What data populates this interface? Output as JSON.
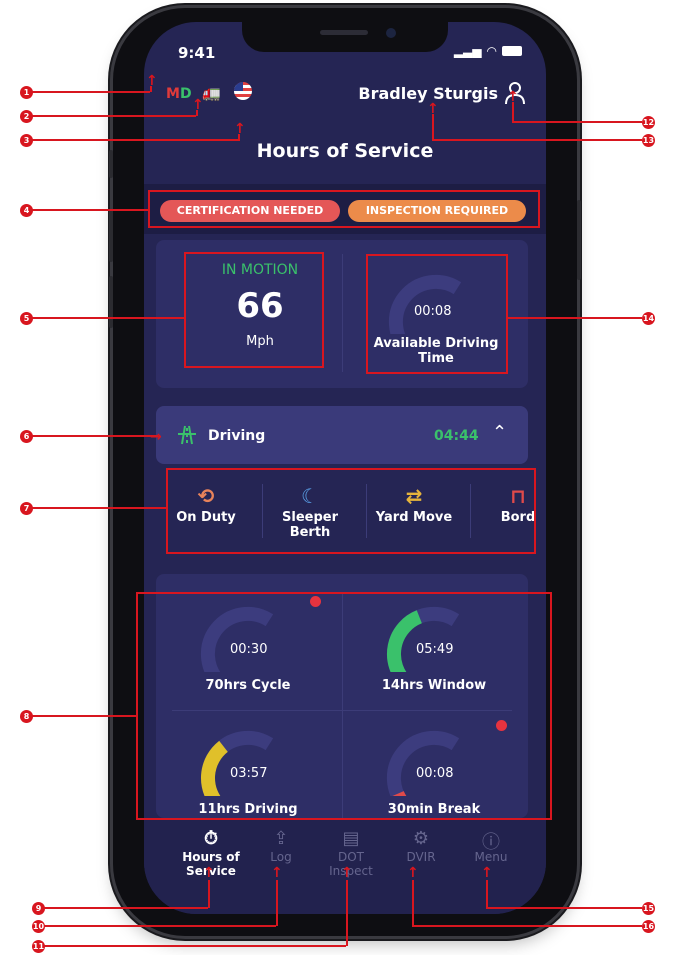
{
  "status_bar": {
    "time": "9:41"
  },
  "header": {
    "md_m": "M",
    "md_d": "D",
    "user_name": "Bradley Sturgis",
    "title": "Hours of Service"
  },
  "alerts": {
    "certification": "CERTIFICATION NEEDED",
    "inspection": "INSPECTION REQUIRED"
  },
  "motion": {
    "status": "IN MOTION",
    "speed": "66",
    "unit": "Mph"
  },
  "available_driving": {
    "time": "00:08",
    "label": "Available Driving Time",
    "fraction": 0.02
  },
  "current_status": {
    "label": "Driving",
    "time": "04:44"
  },
  "status_options": [
    {
      "label": "On Duty",
      "icon": "on-duty-icon",
      "color": "#e8835a"
    },
    {
      "label": "Sleeper Berth",
      "icon": "sleeper-berth-icon",
      "color": "#5aa0e8"
    },
    {
      "label": "Yard Move",
      "icon": "yard-move-icon",
      "color": "#e6b43c"
    },
    {
      "label": "Bord",
      "icon": "border-icon",
      "color": "#e04a4a"
    }
  ],
  "gauges": [
    {
      "time": "00:30",
      "label": "70hrs Cycle",
      "fraction": 0.03,
      "color": "#e04a4a",
      "alert": true
    },
    {
      "time": "05:49",
      "label": "14hrs Window",
      "fraction": 0.42,
      "color": "#3ac16b",
      "alert": false
    },
    {
      "time": "03:57",
      "label": "11hrs Driving",
      "fraction": 0.36,
      "color": "#e0c02a",
      "alert": false
    },
    {
      "time": "00:08",
      "label": "30min Break",
      "fraction": 0.08,
      "color": "#e04a4a",
      "alert": true
    }
  ],
  "nav": [
    {
      "label": "Hours of Service",
      "icon": "stopwatch-icon",
      "active": true
    },
    {
      "label": "Log",
      "icon": "log-upload-icon",
      "active": false
    },
    {
      "label": "DOT Inspect",
      "icon": "clipboard-icon",
      "active": false
    },
    {
      "label": "DVIR",
      "icon": "gear-icon",
      "active": false
    },
    {
      "label": "Menu",
      "icon": "menu-icon",
      "active": false
    }
  ],
  "annotations": [
    "1",
    "2",
    "3",
    "4",
    "5",
    "6",
    "7",
    "8",
    "9",
    "10",
    "11",
    "12",
    "13",
    "14",
    "15",
    "16"
  ],
  "colors": {
    "screen_bg": "#252554",
    "card_bg": "#2e2e66",
    "green": "#3ac16b",
    "red": "#e45757",
    "orange": "#ec8b4a",
    "annotation_red": "#d8161f"
  }
}
